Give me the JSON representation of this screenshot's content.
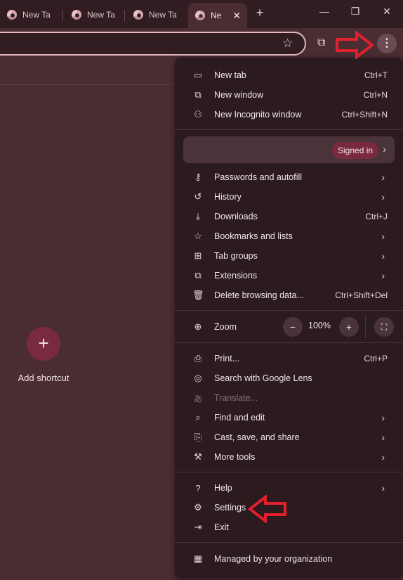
{
  "tabs": [
    {
      "label": "New Ta"
    },
    {
      "label": "New Ta"
    },
    {
      "label": "New Ta"
    },
    {
      "label": "Ne"
    }
  ],
  "window": {
    "new_tab_glyph": "+",
    "minimize": "—",
    "restore": "❐",
    "close": "✕"
  },
  "toolbar": {
    "star_glyph": "☆",
    "extensions_glyph": "⧉",
    "menu_glyph": "⋮"
  },
  "ntp": {
    "add_shortcut_glyph": "+",
    "add_shortcut_label": "Add shortcut"
  },
  "menu": {
    "group1": [
      {
        "icon": "new-tab-icon",
        "glyph": "▭",
        "label": "New tab",
        "shortcut": "Ctrl+T"
      },
      {
        "icon": "new-window-icon",
        "glyph": "⧉",
        "label": "New window",
        "shortcut": "Ctrl+N"
      },
      {
        "icon": "incognito-icon",
        "glyph": "⚇",
        "label": "New Incognito window",
        "shortcut": "Ctrl+Shift+N"
      }
    ],
    "profile": {
      "badge": "Signed in",
      "chevron": "›"
    },
    "group2": [
      {
        "icon": "key-icon",
        "glyph": "⚷",
        "label": "Passwords and autofill",
        "shortcut": "›"
      },
      {
        "icon": "history-icon",
        "glyph": "↺",
        "label": "History",
        "shortcut": "›"
      },
      {
        "icon": "download-icon",
        "glyph": "⤓",
        "label": "Downloads",
        "shortcut": "Ctrl+J"
      },
      {
        "icon": "bookmark-star-icon",
        "glyph": "☆",
        "label": "Bookmarks and lists",
        "shortcut": "›"
      },
      {
        "icon": "tab-groups-icon",
        "glyph": "⊞",
        "label": "Tab groups",
        "shortcut": "›"
      },
      {
        "icon": "extensions-icon",
        "glyph": "⧉",
        "label": "Extensions",
        "shortcut": "›"
      },
      {
        "icon": "trash-icon",
        "glyph": "🗑",
        "label": "Delete browsing data...",
        "shortcut": "Ctrl+Shift+Del"
      }
    ],
    "zoom": {
      "label": "Zoom",
      "glyph": "⊕",
      "minus": "−",
      "value": "100%",
      "plus": "+",
      "fullscreen": "⛶"
    },
    "group3": [
      {
        "icon": "print-icon",
        "glyph": "⎙",
        "label": "Print...",
        "shortcut": "Ctrl+P",
        "disabled": false
      },
      {
        "icon": "lens-icon",
        "glyph": "◎",
        "label": "Search with Google Lens",
        "shortcut": "",
        "disabled": false
      },
      {
        "icon": "translate-icon",
        "glyph": "あ",
        "label": "Translate...",
        "shortcut": "",
        "disabled": true
      },
      {
        "icon": "find-icon",
        "glyph": "⌕",
        "label": "Find and edit",
        "shortcut": "›",
        "disabled": false
      },
      {
        "icon": "cast-icon",
        "glyph": "⎘",
        "label": "Cast, save, and share",
        "shortcut": "›",
        "disabled": false
      },
      {
        "icon": "toolbox-icon",
        "glyph": "⚒",
        "label": "More tools",
        "shortcut": "›",
        "disabled": false
      }
    ],
    "group4": [
      {
        "icon": "help-icon",
        "glyph": "?",
        "label": "Help",
        "shortcut": "›"
      },
      {
        "icon": "gear-icon",
        "glyph": "⚙",
        "label": "Settings",
        "shortcut": ""
      },
      {
        "icon": "exit-icon",
        "glyph": "⇥",
        "label": "Exit",
        "shortcut": ""
      }
    ],
    "managed": {
      "glyph": "▦",
      "label": "Managed by your organization"
    }
  },
  "annotations": {
    "color": "#e0202a"
  }
}
